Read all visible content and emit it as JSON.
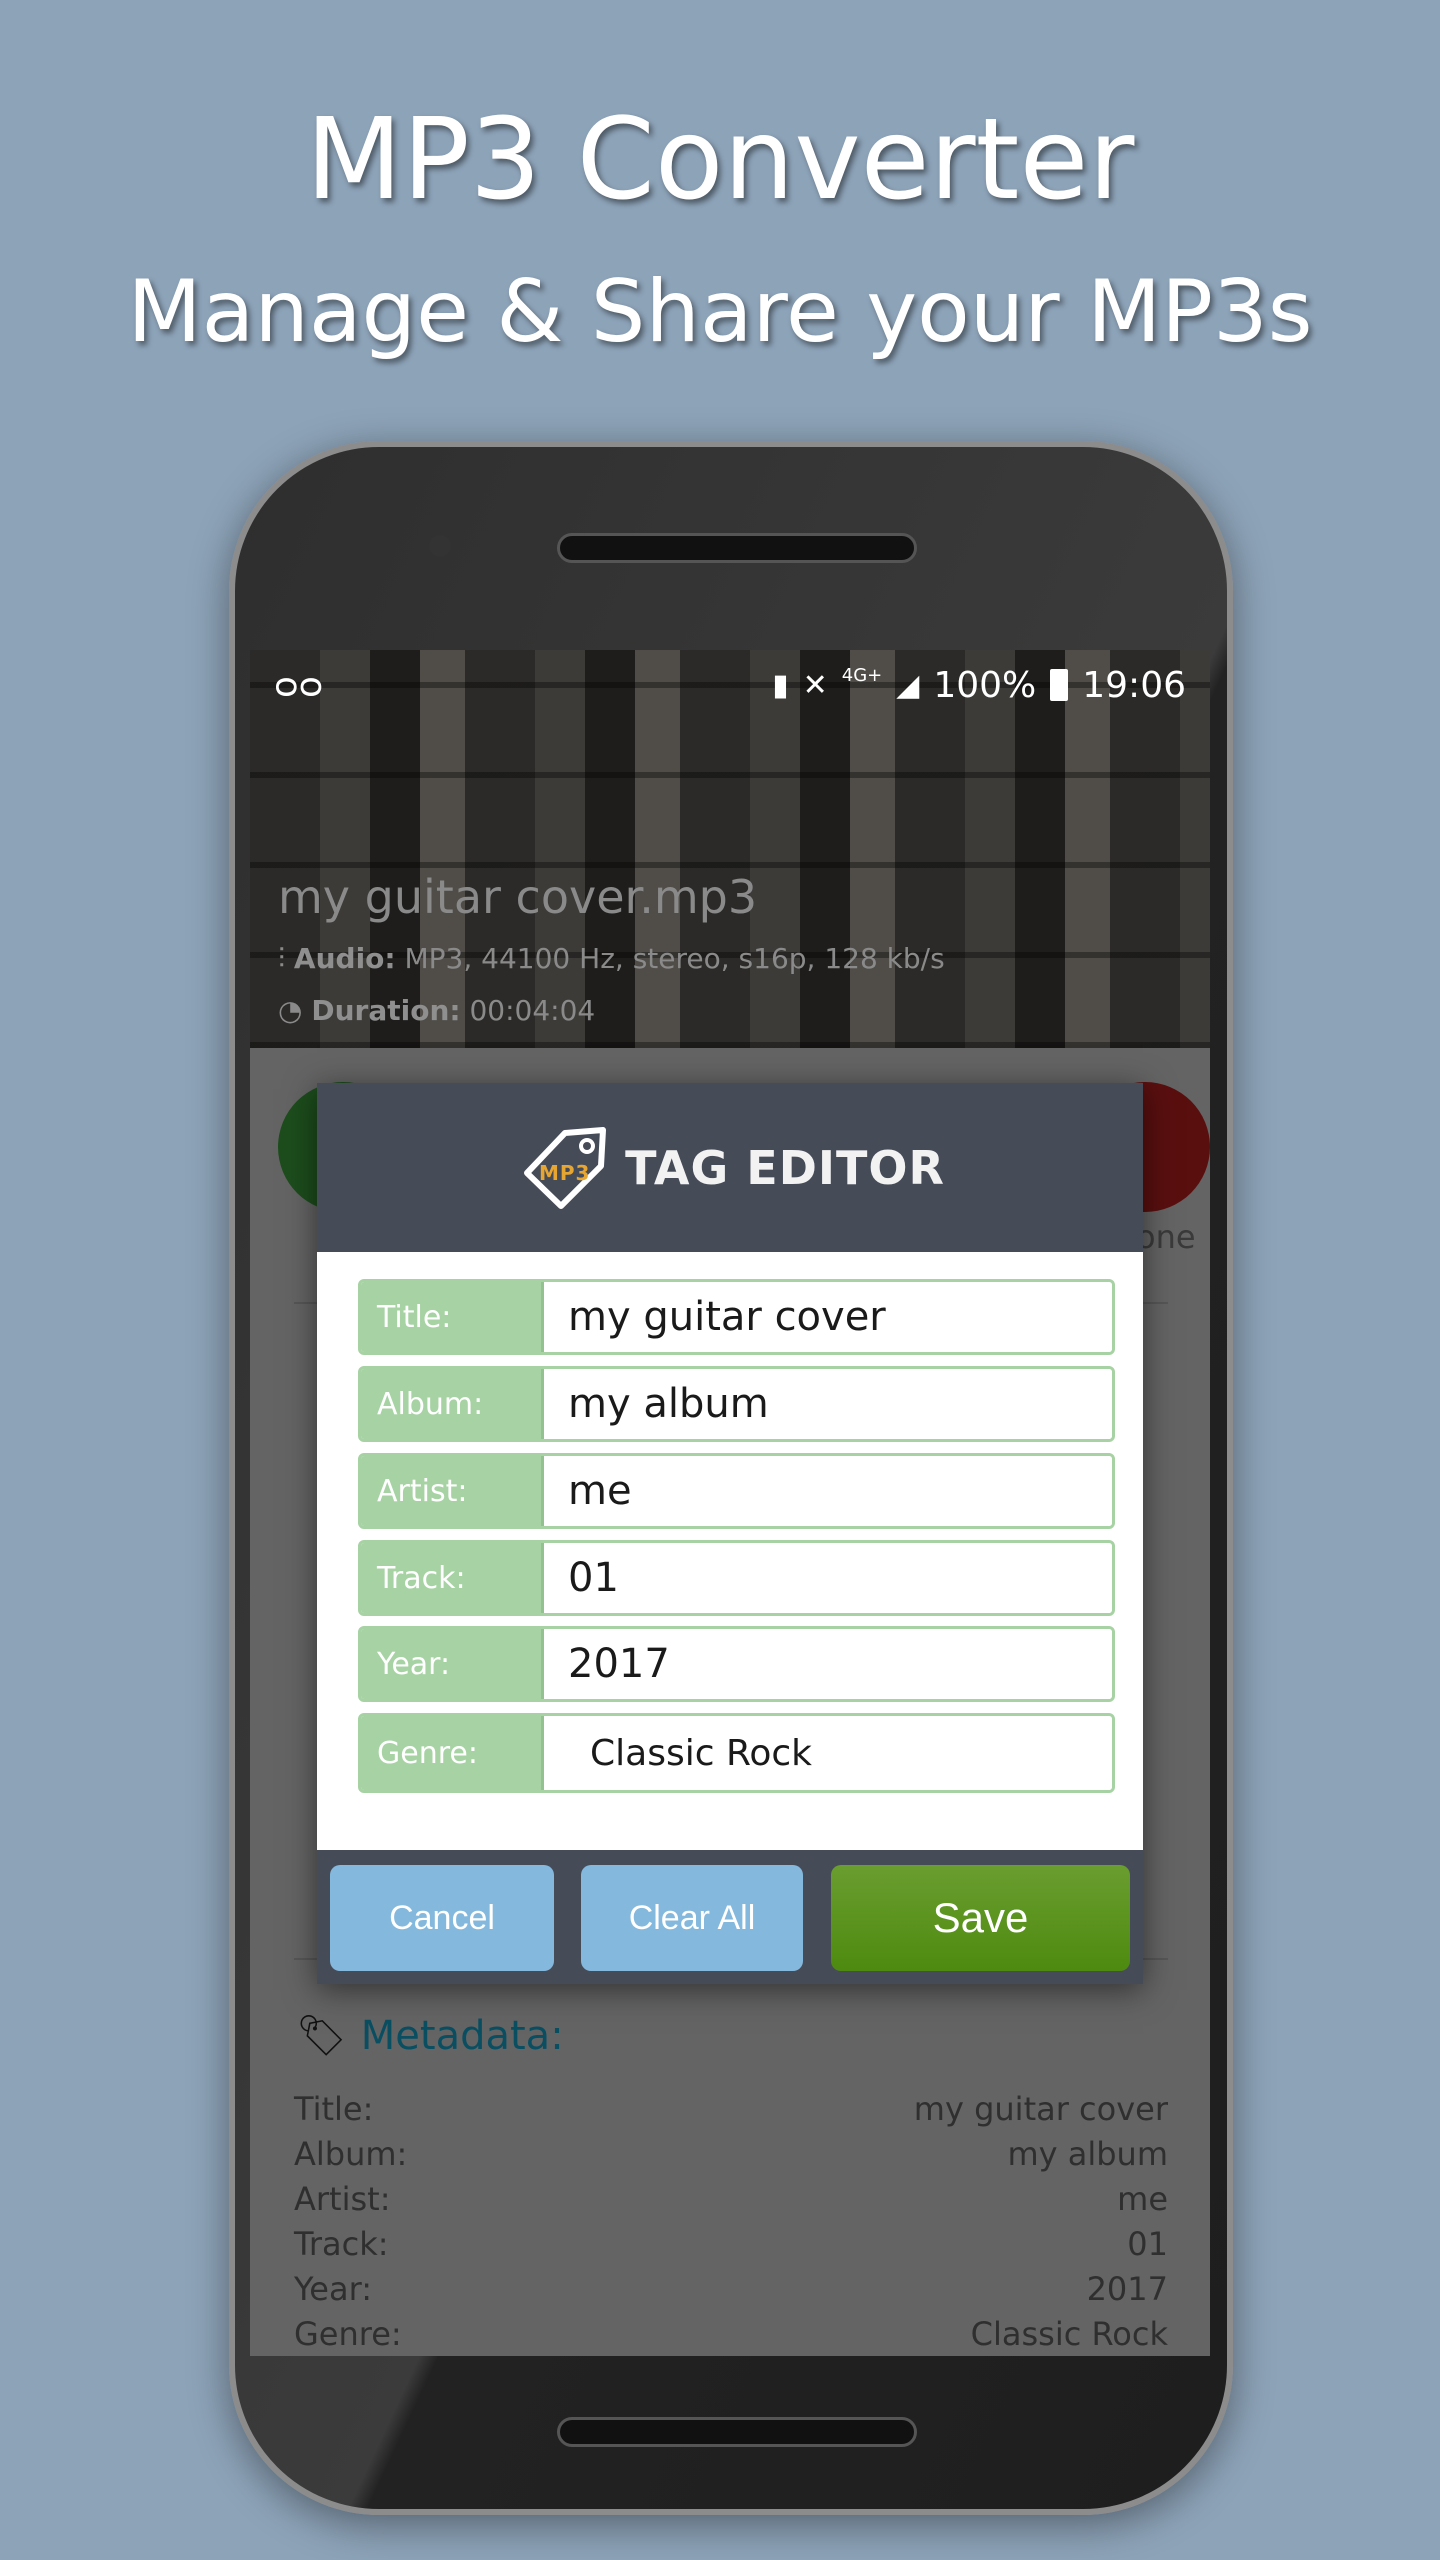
{
  "promo": {
    "title": "MP3 Converter",
    "subtitle": "Manage & Share your MP3s"
  },
  "status_bar": {
    "battery_percent": "100%",
    "time": "19:06",
    "network": "4G+",
    "icons": [
      "voicemail-icon",
      "battery-saver-icon",
      "mute-vibrate-icon",
      "signal-icon",
      "battery-icon"
    ]
  },
  "file": {
    "name": "my guitar cover.mp3",
    "audio_label": "Audio:",
    "audio_value": "MP3, 44100 Hz, stereo, s16p, 128 kb/s",
    "duration_label": "Duration:",
    "duration_value": "00:04:04"
  },
  "background_fragments": {
    "right_label": "one"
  },
  "metadata": {
    "heading": "Metadata:",
    "rows": [
      {
        "label": "Title:",
        "value": "my guitar cover"
      },
      {
        "label": "Album:",
        "value": "my album"
      },
      {
        "label": "Artist:",
        "value": "me"
      },
      {
        "label": "Track:",
        "value": "01"
      },
      {
        "label": "Year:",
        "value": "2017"
      },
      {
        "label": "Genre:",
        "value": "Classic Rock"
      }
    ]
  },
  "dialog": {
    "title": "TAG EDITOR",
    "logo_text": "MP3",
    "fields": [
      {
        "label": "Title:",
        "value": "my guitar cover"
      },
      {
        "label": "Album:",
        "value": "my album"
      },
      {
        "label": "Artist:",
        "value": "me"
      },
      {
        "label": "Track:",
        "value": "01"
      },
      {
        "label": "Year:",
        "value": "2017"
      },
      {
        "label": "Genre:",
        "value": "Classic Rock"
      }
    ],
    "cancel": "Cancel",
    "clear_all": "Clear All",
    "save": "Save"
  },
  "colors": {
    "background": "#8da3b8",
    "dialog_header": "#464b58",
    "label_green": "#a7d3a4",
    "button_blue": "#84b9dd",
    "save_green": "#5a9420",
    "metadata_heading": "#0a4e62"
  }
}
